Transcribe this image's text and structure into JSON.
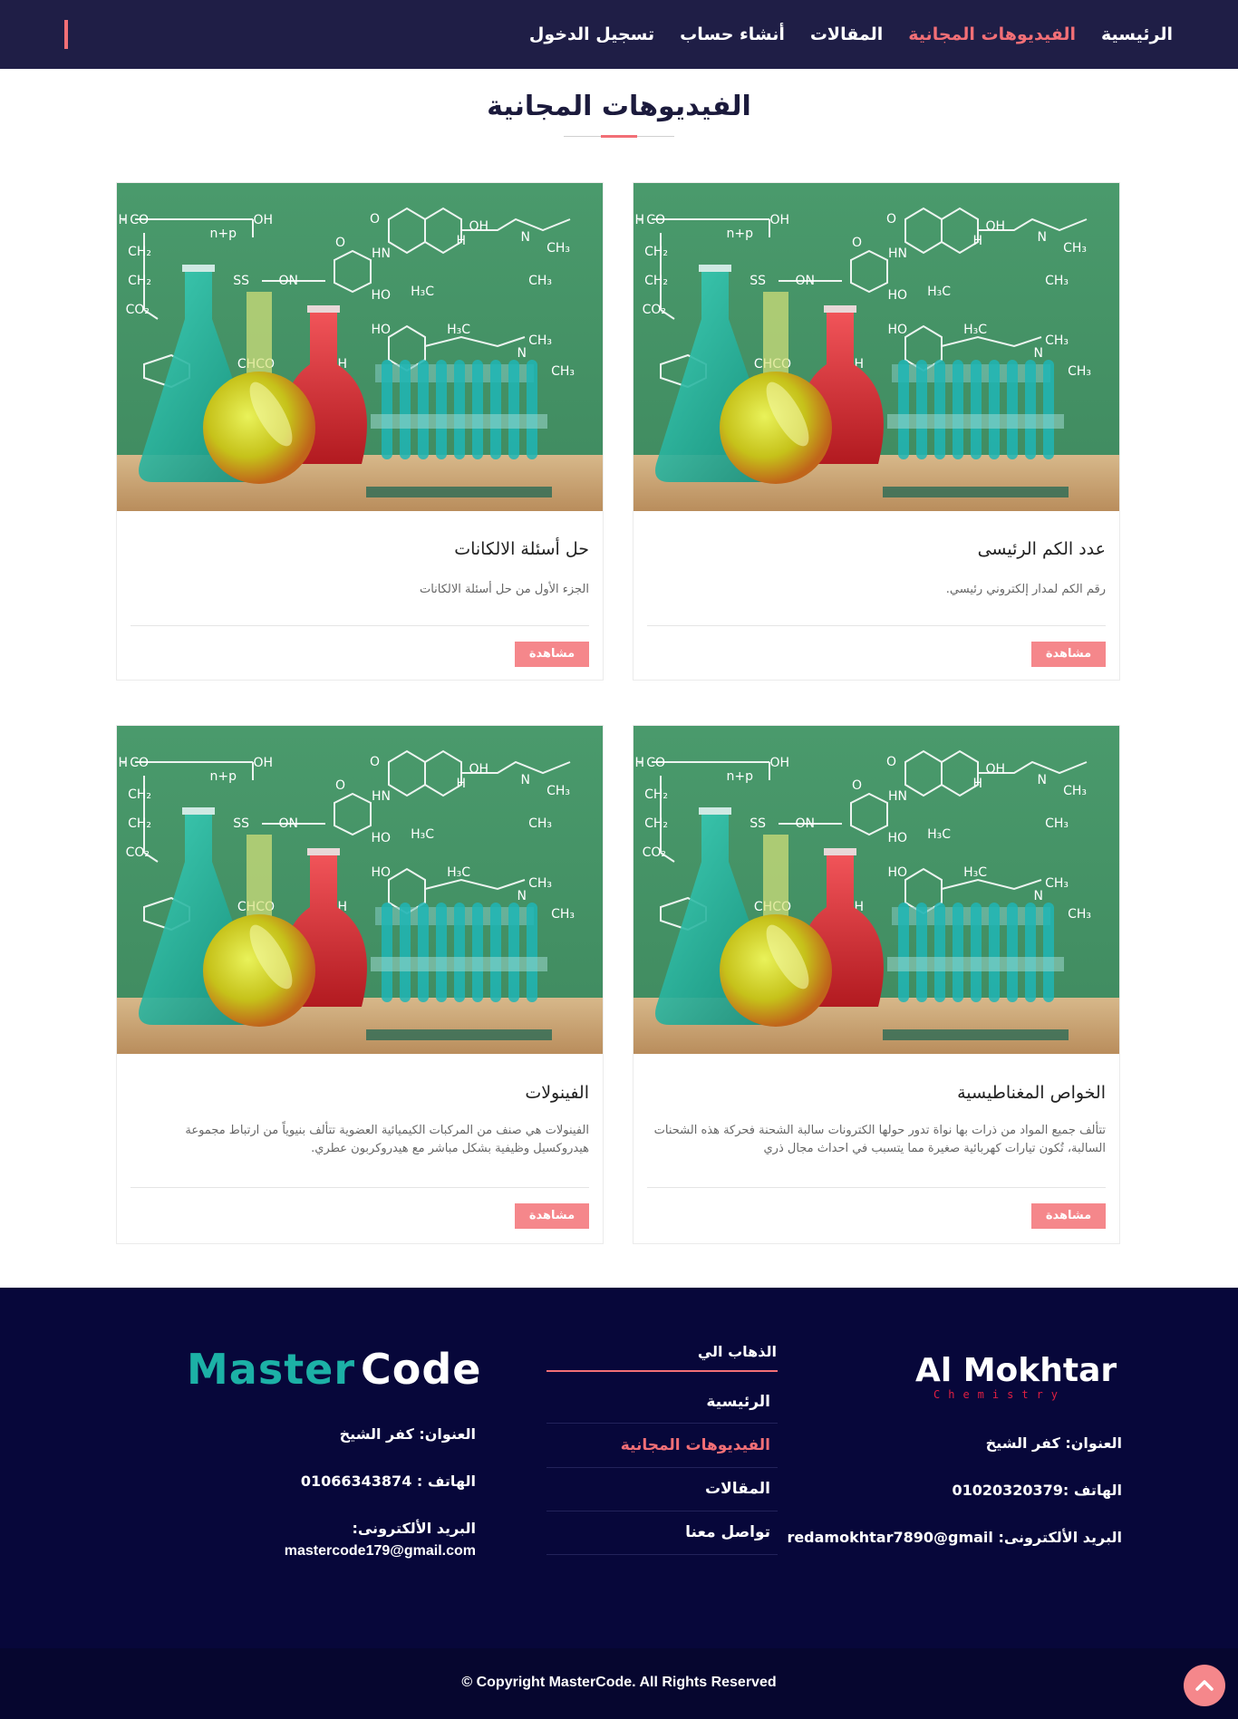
{
  "nav": {
    "links": [
      {
        "label": "الرئيسية",
        "active": false
      },
      {
        "label": "الفيديوهات المجانية",
        "active": true
      },
      {
        "label": "المقالات",
        "active": false
      },
      {
        "label": "أنشاء حساب",
        "active": false
      },
      {
        "label": "تسجيل الدخول",
        "active": false
      }
    ]
  },
  "page": {
    "title": "الفيديوهات المجانية"
  },
  "cards": [
    {
      "title": "عدد الكم الرئيسى",
      "description": "رقم الكم لمدار إلكتروني رئيسي.",
      "button": "مشاهدة"
    },
    {
      "title": "حل أسئلة الالكانات",
      "description": "الجزء الأول من حل أسئلة الالكانات",
      "button": "مشاهدة"
    },
    {
      "title": "الخواص المغناطيسية",
      "description": "تتألف جميع المواد من ذرات بها نواة تدور حولها الكترونات سالبة الشحنة فحركة هذه الشحنات السالبة، تُكون تيارات كهربائية صغيرة مما يتسبب في احداث مجال ذري",
      "button": "مشاهدة"
    },
    {
      "title": "الفينولات",
      "description": "الفينولات هي صنف من المركبات الكيميائية العضوية تتألف بنيوياً من ارتباط مجموعة هيدروكسيل وظيفية بشكل مباشر مع هيدروكربون عطري.",
      "button": "مشاهدة"
    }
  ],
  "footer": {
    "almokhtar": {
      "logo_main": "Al Mokhtar",
      "logo_sub": "Chemistry",
      "address": "العنوان: كفر الشيخ",
      "phone": "الهاتف :01020320379",
      "email": "البريد الألكترونى: redamokhtar7890@gmail"
    },
    "links": {
      "heading": "الذهاب الي",
      "items": [
        {
          "label": "الرئيسية",
          "active": false
        },
        {
          "label": "الفيديوهات المجانية",
          "active": true
        },
        {
          "label": "المقالات",
          "active": false
        },
        {
          "label": "تواصل معنا",
          "active": false
        }
      ]
    },
    "mastercode": {
      "logo_part1": "Master",
      "logo_part2": "Code",
      "address": "العنوان: كفر الشيخ",
      "phone": "الهاتف : 01066343874",
      "email_label": "البريد الألكترونى:",
      "email": "mastercode179@gmail.com"
    },
    "copyright": "© Copyright MasterCode. All Rights Reserved"
  },
  "colors": {
    "nav_bg": "#1f1e46",
    "accent": "#f26f76",
    "button": "#f5878b",
    "footer_bg": "#07073a"
  }
}
